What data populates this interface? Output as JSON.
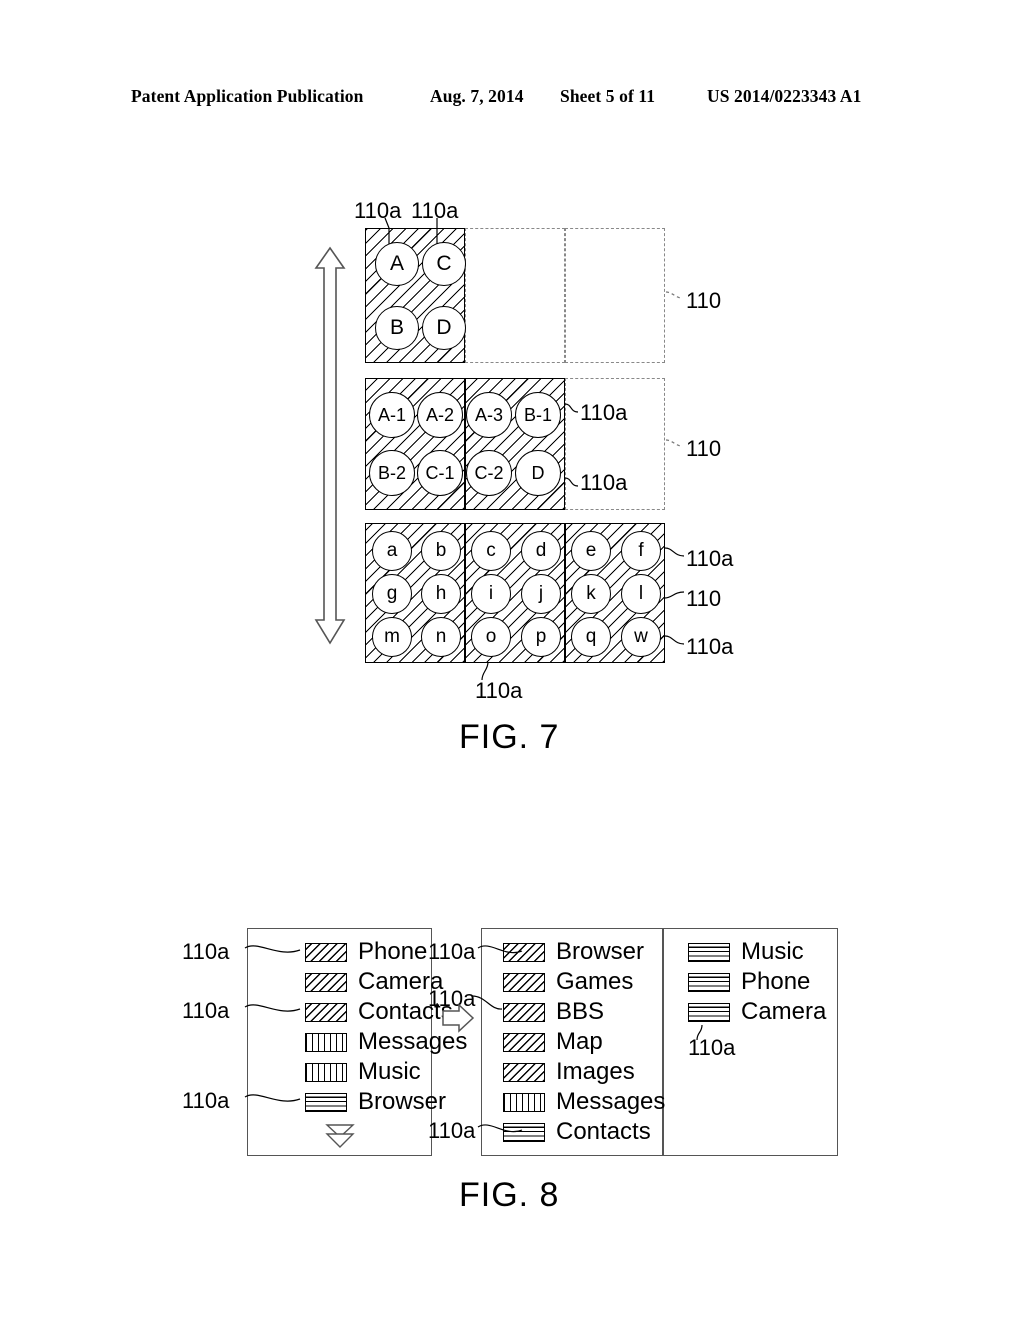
{
  "header": {
    "publication": "Patent Application Publication",
    "date": "Aug. 7, 2014",
    "sheet": "Sheet 5 of 11",
    "patent_number": "US 2014/0223343 A1"
  },
  "fig7": {
    "caption": "FIG. 7",
    "arrow": "double-headed-vertical-arrow",
    "top_labels": [
      "110a",
      "110a"
    ],
    "rows": [
      {
        "id": "row-1",
        "panels": [
          {
            "type": "hatched",
            "columns": 1,
            "circles": [
              [
                "A",
                "C"
              ],
              [
                "B",
                "D"
              ]
            ]
          },
          {
            "type": "empty",
            "columns": 1,
            "circles": []
          },
          {
            "type": "empty",
            "columns": 1,
            "circles": []
          }
        ],
        "right_label": "110"
      },
      {
        "id": "row-2",
        "panels": [
          {
            "type": "hatched",
            "columns": 2,
            "circles": [
              [
                "A-1",
                "A-2"
              ],
              [
                "B-2",
                "C-1"
              ]
            ]
          },
          {
            "type": "hatched",
            "columns": 2,
            "circles": [
              [
                "A-3",
                "B-1"
              ],
              [
                "C-2",
                "D"
              ]
            ]
          },
          {
            "type": "empty",
            "columns": 2,
            "circles": []
          }
        ],
        "inner_labels": [
          "110a",
          "110a"
        ],
        "right_label": "110"
      },
      {
        "id": "row-3",
        "panels": [
          {
            "type": "hatched",
            "columns": 2,
            "circles": [
              [
                "a",
                "b"
              ],
              [
                "g",
                "h"
              ],
              [
                "m",
                "n"
              ]
            ]
          },
          {
            "type": "hatched",
            "columns": 2,
            "circles": [
              [
                "c",
                "d"
              ],
              [
                "i",
                "j"
              ],
              [
                "o",
                "p"
              ]
            ]
          },
          {
            "type": "hatched",
            "columns": 2,
            "circles": [
              [
                "e",
                "f"
              ],
              [
                "k",
                "l"
              ],
              [
                "q",
                "w"
              ]
            ]
          }
        ],
        "right_labels": [
          "110a",
          "110",
          "110a"
        ],
        "bottom_label": "110a"
      }
    ]
  },
  "fig8": {
    "caption": "FIG. 8",
    "transition_arrow": "right-arrow-icon",
    "more_indicator": "double-chevron-down-icon",
    "left_labels": [
      "110a",
      "110a",
      "110a"
    ],
    "middle_labels": [
      "110a",
      "110a",
      "110a"
    ],
    "right_label": "110a",
    "boxes": [
      {
        "id": "left-list",
        "items": [
          {
            "label": "Phone",
            "pattern": "diag"
          },
          {
            "label": "Camera",
            "pattern": "diag"
          },
          {
            "label": "Contacts",
            "pattern": "diag"
          },
          {
            "label": "Messages",
            "pattern": "vert"
          },
          {
            "label": "Music",
            "pattern": "vert"
          },
          {
            "label": "Browser",
            "pattern": "horz"
          }
        ]
      },
      {
        "id": "middle-list",
        "items": [
          {
            "label": "Browser",
            "pattern": "diag"
          },
          {
            "label": "Games",
            "pattern": "diag"
          },
          {
            "label": "BBS",
            "pattern": "diag"
          },
          {
            "label": "Map",
            "pattern": "diag"
          },
          {
            "label": "Images",
            "pattern": "diag"
          },
          {
            "label": "Messages",
            "pattern": "vert"
          },
          {
            "label": "Contacts",
            "pattern": "horz"
          }
        ]
      },
      {
        "id": "right-list",
        "items": [
          {
            "label": "Music",
            "pattern": "horz"
          },
          {
            "label": "Phone",
            "pattern": "horz"
          },
          {
            "label": "Camera",
            "pattern": "horz"
          }
        ]
      }
    ]
  }
}
